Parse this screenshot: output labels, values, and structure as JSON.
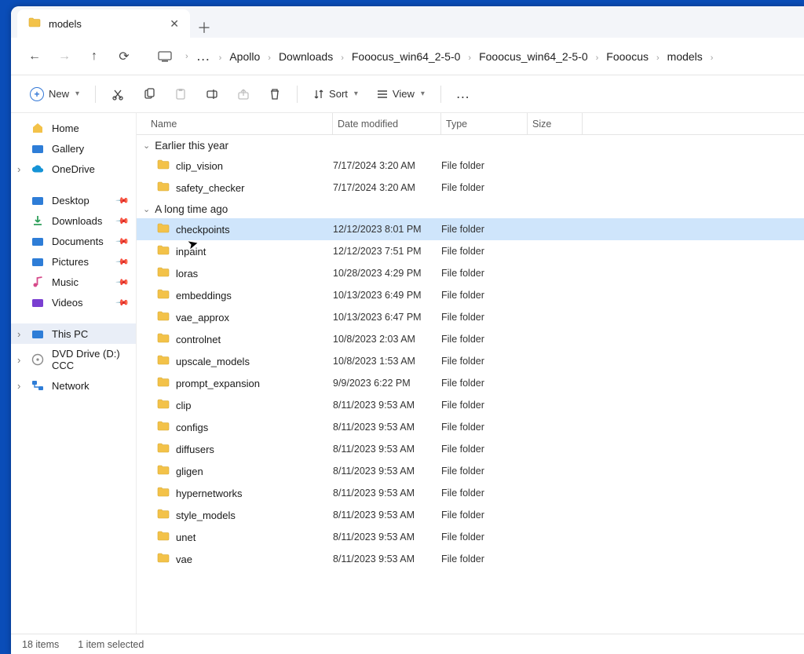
{
  "tab": {
    "title": "models"
  },
  "breadcrumbs": [
    "Apollo",
    "Downloads",
    "Fooocus_win64_2-5-0",
    "Fooocus_win64_2-5-0",
    "Fooocus",
    "models"
  ],
  "toolbar": {
    "new": "New",
    "sort": "Sort",
    "view": "View"
  },
  "columns": {
    "name": "Name",
    "date": "Date modified",
    "type": "Type",
    "size": "Size"
  },
  "sidebar": {
    "top": [
      {
        "label": "Home",
        "icon": "home"
      },
      {
        "label": "Gallery",
        "icon": "gallery"
      },
      {
        "label": "OneDrive",
        "icon": "onedrive",
        "expander": true
      }
    ],
    "pinned": [
      {
        "label": "Desktop",
        "icon": "desktop"
      },
      {
        "label": "Downloads",
        "icon": "downloads"
      },
      {
        "label": "Documents",
        "icon": "documents"
      },
      {
        "label": "Pictures",
        "icon": "pictures"
      },
      {
        "label": "Music",
        "icon": "music"
      },
      {
        "label": "Videos",
        "icon": "videos"
      }
    ],
    "bottom": [
      {
        "label": "This PC",
        "icon": "pc",
        "expander": true,
        "selected": true
      },
      {
        "label": "DVD Drive (D:) CCC",
        "icon": "dvd",
        "expander": true
      },
      {
        "label": "Network",
        "icon": "net",
        "expander": true
      }
    ]
  },
  "groups": [
    {
      "label": "Earlier this year",
      "items": [
        {
          "name": "clip_vision",
          "date": "7/17/2024 3:20 AM",
          "type": "File folder"
        },
        {
          "name": "safety_checker",
          "date": "7/17/2024 3:20 AM",
          "type": "File folder"
        }
      ]
    },
    {
      "label": "A long time ago",
      "items": [
        {
          "name": "checkpoints",
          "date": "12/12/2023 8:01 PM",
          "type": "File folder",
          "selected": true
        },
        {
          "name": "inpaint",
          "date": "12/12/2023 7:51 PM",
          "type": "File folder"
        },
        {
          "name": "loras",
          "date": "10/28/2023 4:29 PM",
          "type": "File folder"
        },
        {
          "name": "embeddings",
          "date": "10/13/2023 6:49 PM",
          "type": "File folder"
        },
        {
          "name": "vae_approx",
          "date": "10/13/2023 6:47 PM",
          "type": "File folder"
        },
        {
          "name": "controlnet",
          "date": "10/8/2023 2:03 AM",
          "type": "File folder"
        },
        {
          "name": "upscale_models",
          "date": "10/8/2023 1:53 AM",
          "type": "File folder"
        },
        {
          "name": "prompt_expansion",
          "date": "9/9/2023 6:22 PM",
          "type": "File folder"
        },
        {
          "name": "clip",
          "date": "8/11/2023 9:53 AM",
          "type": "File folder"
        },
        {
          "name": "configs",
          "date": "8/11/2023 9:53 AM",
          "type": "File folder"
        },
        {
          "name": "diffusers",
          "date": "8/11/2023 9:53 AM",
          "type": "File folder"
        },
        {
          "name": "gligen",
          "date": "8/11/2023 9:53 AM",
          "type": "File folder"
        },
        {
          "name": "hypernetworks",
          "date": "8/11/2023 9:53 AM",
          "type": "File folder"
        },
        {
          "name": "style_models",
          "date": "8/11/2023 9:53 AM",
          "type": "File folder"
        },
        {
          "name": "unet",
          "date": "8/11/2023 9:53 AM",
          "type": "File folder"
        },
        {
          "name": "vae",
          "date": "8/11/2023 9:53 AM",
          "type": "File folder"
        }
      ]
    }
  ],
  "status": {
    "count": "18 items",
    "selected": "1 item selected"
  }
}
